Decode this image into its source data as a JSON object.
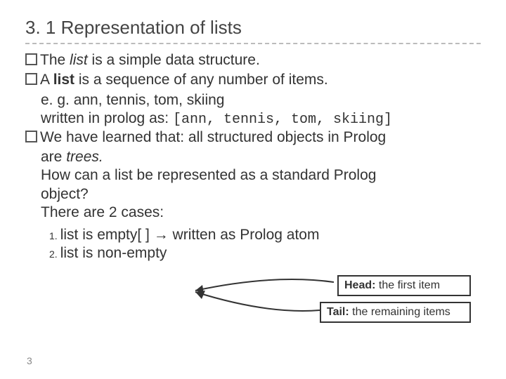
{
  "title": "3. 1 Representation of lists",
  "b1": {
    "pre": "The ",
    "em": "list",
    "post": " is a simple data structure."
  },
  "b2": {
    "pre": "A ",
    "bold": "list",
    "post": " is a sequence of any number of items.",
    "eg": "e. g.   ann, tennis, tom, skiing",
    "written": "written in prolog as: ",
    "code": "[ann, tennis, tom, skiing]"
  },
  "b3": {
    "line1a": "We have learned that: all structured objects in Prolog",
    "line1b": "are ",
    "em": "trees.",
    "q1": "How can a list be represented as a standard Prolog",
    "q2": "object?",
    "cases": "There are 2 cases:"
  },
  "ol": {
    "n1": "1.",
    "i1a": "list is empty[ ] ",
    "arrow": "→",
    "i1b": " written as Prolog atom",
    "n2": "2.",
    "i2": "list is non-empty"
  },
  "callouts": {
    "head_label": "Head:",
    "head_text": " the first item",
    "tail_label": "Tail:",
    "tail_text": "  the remaining items"
  },
  "page": "3"
}
